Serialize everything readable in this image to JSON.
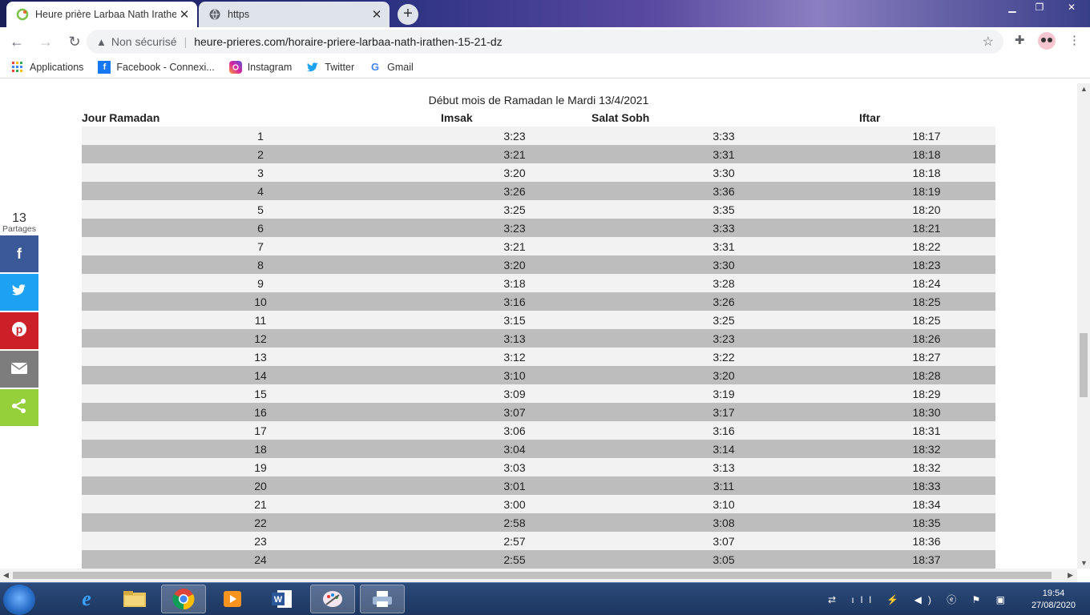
{
  "browser": {
    "tabs": [
      {
        "title": "Heure prière Larbaa Nath Irathen",
        "active": true
      },
      {
        "title": "https",
        "active": false
      }
    ],
    "security_label": "Non sécurisé",
    "url": "heure-prieres.com/horaire-priere-larbaa-nath-irathen-15-21-dz",
    "bookmarks": [
      "Applications",
      "Facebook - Connexi...",
      "Instagram",
      "Twitter",
      "Gmail"
    ]
  },
  "page": {
    "caption": "Début mois de Ramadan le Mardi 13/4/2021",
    "headers": {
      "day": "Jour Ramadan",
      "imsak": "Imsak",
      "sobh": "Salat Sobh",
      "iftar": "Iftar"
    },
    "rows": [
      [
        "1",
        "3:23",
        "3:33",
        "18:17"
      ],
      [
        "2",
        "3:21",
        "3:31",
        "18:18"
      ],
      [
        "3",
        "3:20",
        "3:30",
        "18:18"
      ],
      [
        "4",
        "3:26",
        "3:36",
        "18:19"
      ],
      [
        "5",
        "3:25",
        "3:35",
        "18:20"
      ],
      [
        "6",
        "3:23",
        "3:33",
        "18:21"
      ],
      [
        "7",
        "3:21",
        "3:31",
        "18:22"
      ],
      [
        "8",
        "3:20",
        "3:30",
        "18:23"
      ],
      [
        "9",
        "3:18",
        "3:28",
        "18:24"
      ],
      [
        "10",
        "3:16",
        "3:26",
        "18:25"
      ],
      [
        "11",
        "3:15",
        "3:25",
        "18:25"
      ],
      [
        "12",
        "3:13",
        "3:23",
        "18:26"
      ],
      [
        "13",
        "3:12",
        "3:22",
        "18:27"
      ],
      [
        "14",
        "3:10",
        "3:20",
        "18:28"
      ],
      [
        "15",
        "3:09",
        "3:19",
        "18:29"
      ],
      [
        "16",
        "3:07",
        "3:17",
        "18:30"
      ],
      [
        "17",
        "3:06",
        "3:16",
        "18:31"
      ],
      [
        "18",
        "3:04",
        "3:14",
        "18:32"
      ],
      [
        "19",
        "3:03",
        "3:13",
        "18:32"
      ],
      [
        "20",
        "3:01",
        "3:11",
        "18:33"
      ],
      [
        "21",
        "3:00",
        "3:10",
        "18:34"
      ],
      [
        "22",
        "2:58",
        "3:08",
        "18:35"
      ],
      [
        "23",
        "2:57",
        "3:07",
        "18:36"
      ],
      [
        "24",
        "2:55",
        "3:05",
        "18:37"
      ]
    ]
  },
  "share": {
    "count": "13",
    "label": "Partages",
    "buttons": [
      {
        "name": "facebook",
        "glyph": "f",
        "color": "#3b5998"
      },
      {
        "name": "twitter",
        "glyph": "🐦",
        "color": "#1da1f2"
      },
      {
        "name": "pinterest",
        "glyph": "℗",
        "color": "#cb2027"
      },
      {
        "name": "email",
        "glyph": "✉",
        "color": "#7d7d7d"
      },
      {
        "name": "sharethis",
        "glyph": "⋖",
        "color": "#95d03a"
      }
    ]
  },
  "taskbar": {
    "time": "19:54",
    "date": "27/08/2020"
  }
}
